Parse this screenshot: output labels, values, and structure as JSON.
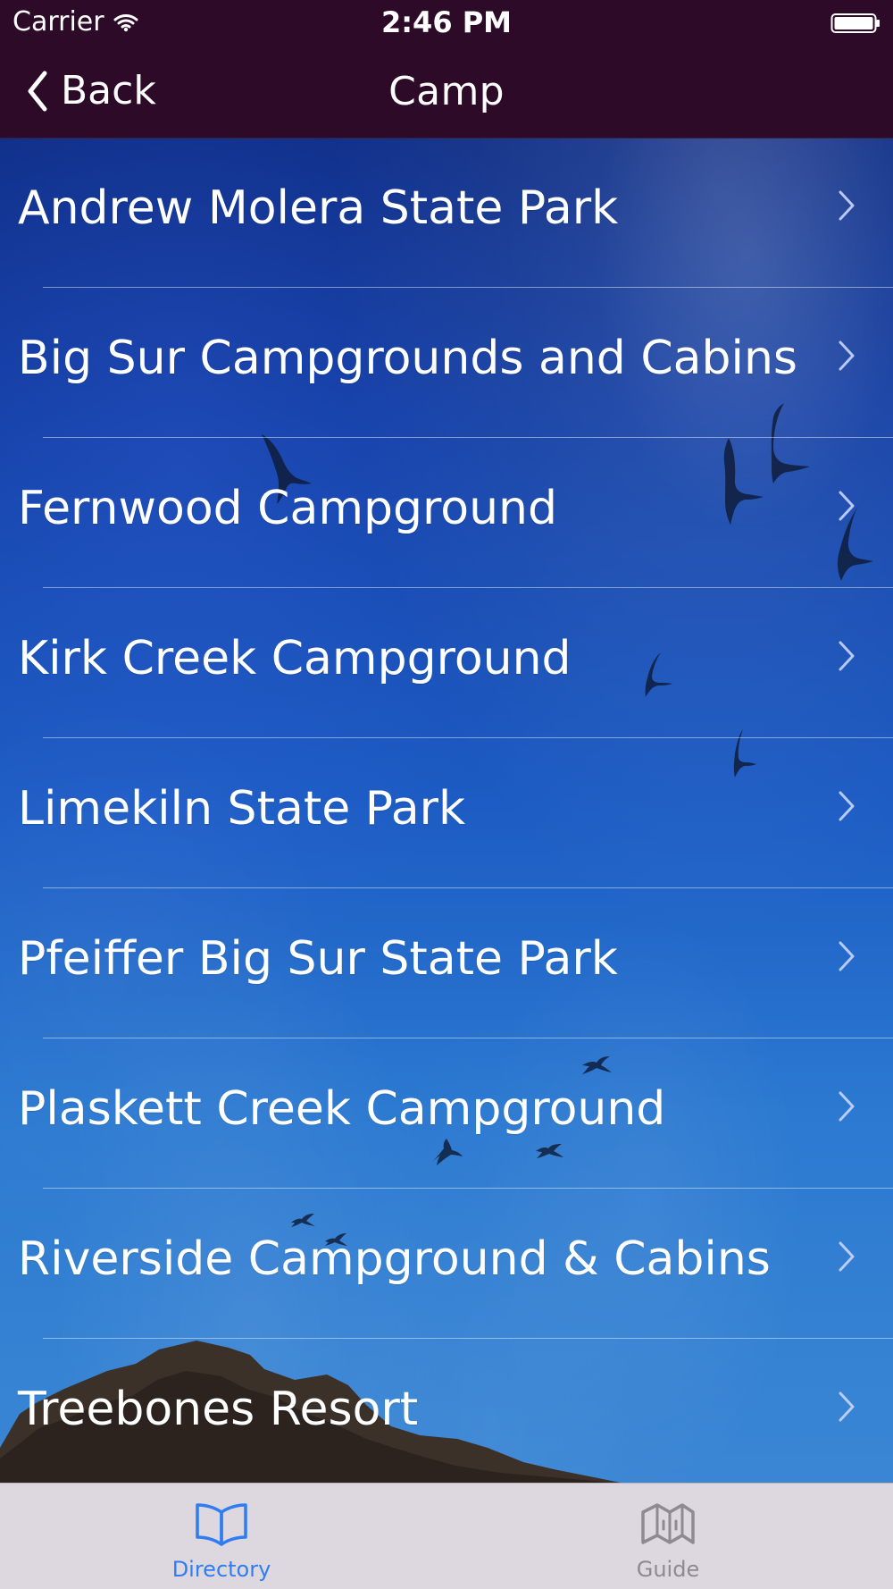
{
  "status_bar": {
    "carrier": "Carrier",
    "time": "2:46 PM"
  },
  "nav": {
    "back_label": "Back",
    "title": "Camp"
  },
  "list": {
    "items": [
      {
        "label": "Andrew Molera State Park"
      },
      {
        "label": "Big Sur Campgrounds and Cabins"
      },
      {
        "label": "Fernwood Campground"
      },
      {
        "label": "Kirk Creek Campground"
      },
      {
        "label": "Limekiln State Park"
      },
      {
        "label": "Pfeiffer Big Sur State Park"
      },
      {
        "label": "Plaskett Creek Campground"
      },
      {
        "label": "Riverside Campground & Cabins"
      },
      {
        "label": "Treebones Resort"
      }
    ]
  },
  "tabs": [
    {
      "label": "Directory",
      "icon": "book-icon"
    },
    {
      "label": "Guide",
      "icon": "map-icon"
    }
  ],
  "colors": {
    "nav_background": "#2d0a27",
    "tab_active": "#2f7df0",
    "tab_inactive": "#8e8a91",
    "tab_background": "#ddd7df"
  }
}
